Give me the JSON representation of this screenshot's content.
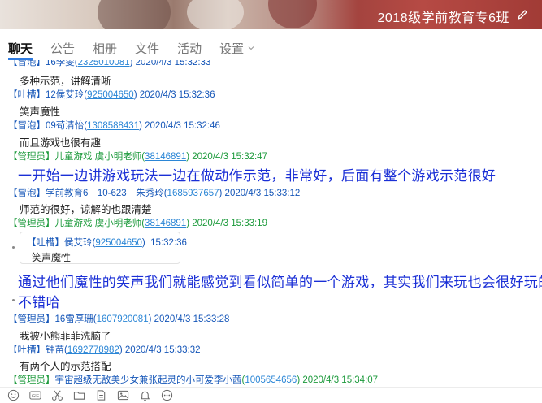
{
  "banner": {
    "title": "2018级学前教育专6班"
  },
  "tabs": [
    {
      "label": "聊天"
    },
    {
      "label": "公告"
    },
    {
      "label": "相册"
    },
    {
      "label": "文件"
    },
    {
      "label": "活动"
    },
    {
      "label": "设置"
    }
  ],
  "messages": [
    {
      "role": "【冒泡】",
      "name": "16李雯",
      "qq": "2325010081",
      "time": "2020/4/3 15:32:33",
      "body": "多种示范，讲解清晰"
    },
    {
      "role": "【吐槽】",
      "name": "12侯艾玲",
      "qq": "925004650",
      "time": "2020/4/3 15:32:36",
      "body": "笑声魔性"
    },
    {
      "role": "【冒泡】",
      "name": "09苟清怡",
      "qq": "1308588431",
      "time": "2020/4/3 15:32:46",
      "body": "而且游戏也很有趣"
    },
    {
      "role": "【管理员】",
      "name": "儿童游戏 虞小明老师",
      "qq": "38146891",
      "time": "2020/4/3 15:32:47",
      "body": "一开始一边讲游戏玩法一边在做动作示范，非常好，后面有整个游戏示范很好"
    },
    {
      "role": "【冒泡】",
      "name": "学前教育6　10-623　朱秀玲",
      "qq": "1685937657",
      "time": "2020/4/3 15:33:12",
      "body": "师范的很好，谅解的也跟清楚"
    },
    {
      "role": "【管理员】",
      "name": "儿童游戏 虞小明老师",
      "qq": "38146891",
      "time": "2020/4/3 15:33:19"
    },
    {
      "role": "【管理员】",
      "name": "16雷厚珊",
      "qq": "1607920081",
      "time": "2020/4/3 15:33:28",
      "body": "我被小熊菲菲洗脑了"
    },
    {
      "role": "【吐槽】",
      "name": "钟苗",
      "qq": "1692778982",
      "time": "2020/4/3 15:33:32",
      "body": "有两个人的示范搭配"
    },
    {
      "role": "【管理员】",
      "name": "宇宙超级无敌美少女兼张起灵的小可爱李小茜",
      "qq": "1005654656",
      "time": "2020/4/3 15:34:07"
    }
  ],
  "quote": {
    "role": "【吐槽】",
    "name": "侯艾玲",
    "qq": "925004650",
    "time": "15:32:36",
    "body": "笑声魔性"
  },
  "reply": {
    "line1": "通过他们魔性的笑声我们就能感觉到看似简单的一个游戏，其实我们来玩也会很好玩的",
    "line2": "不错哈"
  },
  "toolbar": [
    "emoji-icon",
    "gif-icon",
    "scissors-icon",
    "folder-icon",
    "document-icon",
    "image-icon",
    "bell-icon",
    "more-icon"
  ]
}
